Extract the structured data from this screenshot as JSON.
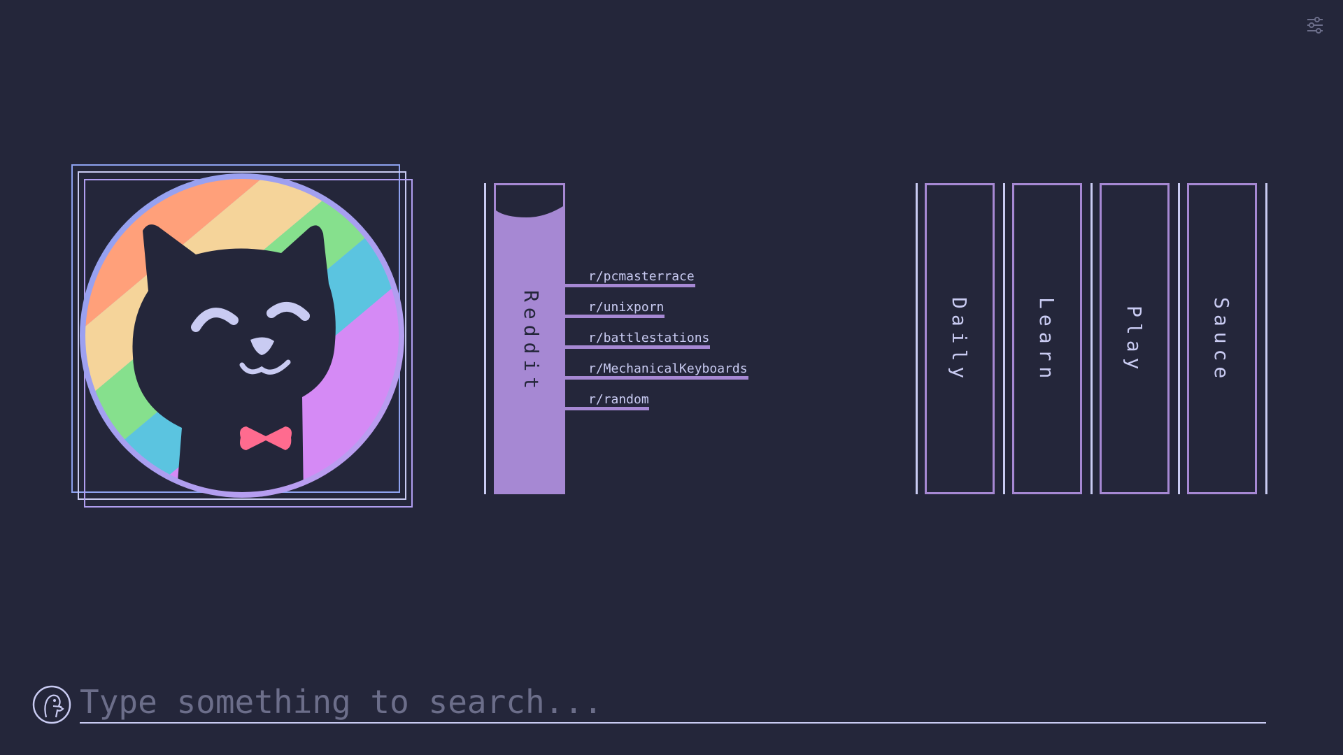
{
  "colors": {
    "background": "#24263a",
    "accent": "#a688d3",
    "text": "#c9cbf2",
    "placeholder": "#6c6e8a"
  },
  "settings": {
    "icon": "sliders-icon"
  },
  "avatar": {
    "icon": "cat-avatar-icon"
  },
  "reddit": {
    "label": "Reddit",
    "links": [
      {
        "label": "r/pcmasterrace"
      },
      {
        "label": "r/unixporn"
      },
      {
        "label": "r/battlestations"
      },
      {
        "label": "r/MechanicalKeyboards"
      },
      {
        "label": "r/random"
      }
    ]
  },
  "tabs": [
    {
      "label": "Daily"
    },
    {
      "label": "Learn"
    },
    {
      "label": "Play"
    },
    {
      "label": "Sauce"
    }
  ],
  "search": {
    "placeholder": "Type something to search...",
    "value": "",
    "icon": "duckduckgo-icon"
  }
}
